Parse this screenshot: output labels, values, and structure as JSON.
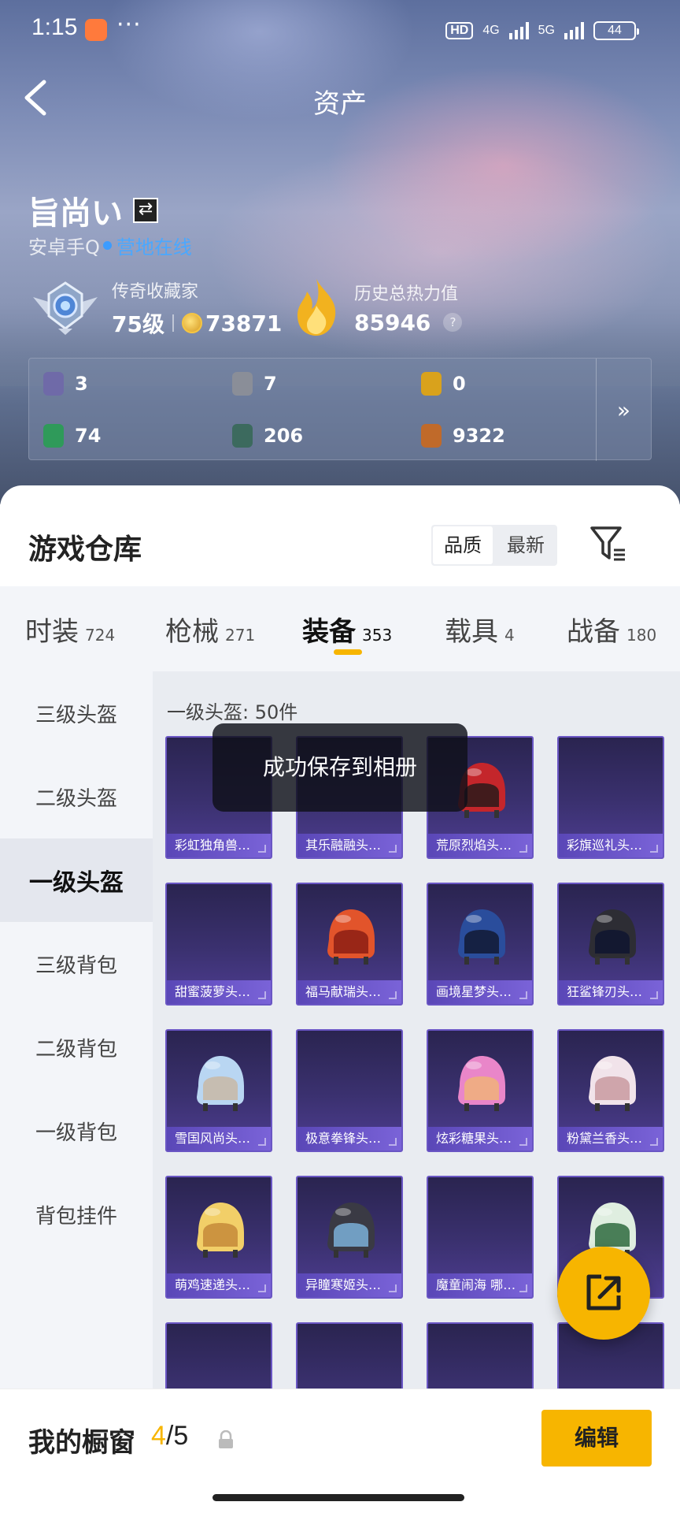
{
  "status": {
    "time": "1:15",
    "more": "···",
    "hd": "HD",
    "net1": "4G",
    "net2": "5G",
    "battery": "44"
  },
  "header": {
    "title": "资产"
  },
  "profile": {
    "name": "旨尚い",
    "platform": "安卓手Q",
    "online_status": "营地在线",
    "rank_title": "传奇收藏家",
    "level": "75级",
    "coins": "73871",
    "heat_title": "历史总热力值",
    "heat_value": "85946",
    "help": "?"
  },
  "resources": [
    {
      "icon": "card-icon",
      "value": "3",
      "color": "#6f6aa8"
    },
    {
      "icon": "badge-icon",
      "value": "7",
      "color": "#8a8e98"
    },
    {
      "icon": "token-icon",
      "value": "0",
      "color": "#d9a21c"
    },
    {
      "icon": "ticket-icon",
      "value": "74",
      "color": "#2f9a5a"
    },
    {
      "icon": "orb-icon",
      "value": "206",
      "color": "#3c6a5e"
    },
    {
      "icon": "bronze-coin-icon",
      "value": "9322",
      "color": "#c06a2a"
    }
  ],
  "resources_more": "»",
  "warehouse": {
    "title": "游戏仓库",
    "sort_options": [
      "品质",
      "最新"
    ],
    "sort_active": "品质"
  },
  "category_tabs": [
    {
      "label": "时装",
      "count": "724"
    },
    {
      "label": "枪械",
      "count": "271"
    },
    {
      "label": "装备",
      "count": "353",
      "active": true
    },
    {
      "label": "载具",
      "count": "4"
    },
    {
      "label": "战备",
      "count": "180"
    }
  ],
  "sub_categories": [
    "三级头盔",
    "二级头盔",
    "一级头盔",
    "三级背包",
    "二级背包",
    "一级背包",
    "背包挂件"
  ],
  "active_sub_category": "一级头盔",
  "content_header": "一级头盔: 50件",
  "items": [
    {
      "name": "彩虹独角兽…",
      "helmet": "",
      "accent": ""
    },
    {
      "name": "其乐融融头…",
      "helmet": "",
      "accent": ""
    },
    {
      "name": "荒原烈焰头…",
      "helmet": "#c4262b",
      "accent": "#2a1a1a"
    },
    {
      "name": "彩旗巡礼头…",
      "helmet": "",
      "accent": ""
    },
    {
      "name": "甜蜜菠萝头…",
      "helmet": "",
      "accent": ""
    },
    {
      "name": "福马献瑞头…",
      "helmet": "#e2542b",
      "accent": "#8c1e14"
    },
    {
      "name": "画境星梦头…",
      "helmet": "#2a4d9c",
      "accent": "#121a34"
    },
    {
      "name": "狂鲨锋刃头…",
      "helmet": "#2d2d34",
      "accent": "#0f1530"
    },
    {
      "name": "雪国风尚头…",
      "helmet": "#b9d6f2",
      "accent": "#c8b8a6"
    },
    {
      "name": "极意拳锋头…",
      "helmet": "",
      "accent": ""
    },
    {
      "name": "炫彩糖果头…",
      "helmet": "#e986c9",
      "accent": "#f0b27a"
    },
    {
      "name": "粉黛兰香头…",
      "helmet": "#f1e3ea",
      "accent": "#c99aa0"
    },
    {
      "name": "萌鸡速递头…",
      "helmet": "#f2cf68",
      "accent": "#c68a3a"
    },
    {
      "name": "异瞳寒姬头…",
      "helmet": "#3a3a44",
      "accent": "#7bb0d8"
    },
    {
      "name": "魔童闹海 哪…",
      "helmet": "",
      "accent": ""
    },
    {
      "name": "",
      "helmet": "#dfeee0",
      "accent": "#2f6a3e"
    },
    {
      "name": "",
      "helmet": "",
      "accent": ""
    },
    {
      "name": "",
      "helmet": "",
      "accent": ""
    },
    {
      "name": "",
      "helmet": "",
      "accent": ""
    },
    {
      "name": "",
      "helmet": "",
      "accent": ""
    }
  ],
  "toast": "成功保存到相册",
  "showcase": {
    "label": "我的橱窗",
    "current": "4",
    "total": "/5",
    "edit": "编辑"
  },
  "colors": {
    "accent": "#f7b500",
    "online": "#4aa8ff"
  }
}
